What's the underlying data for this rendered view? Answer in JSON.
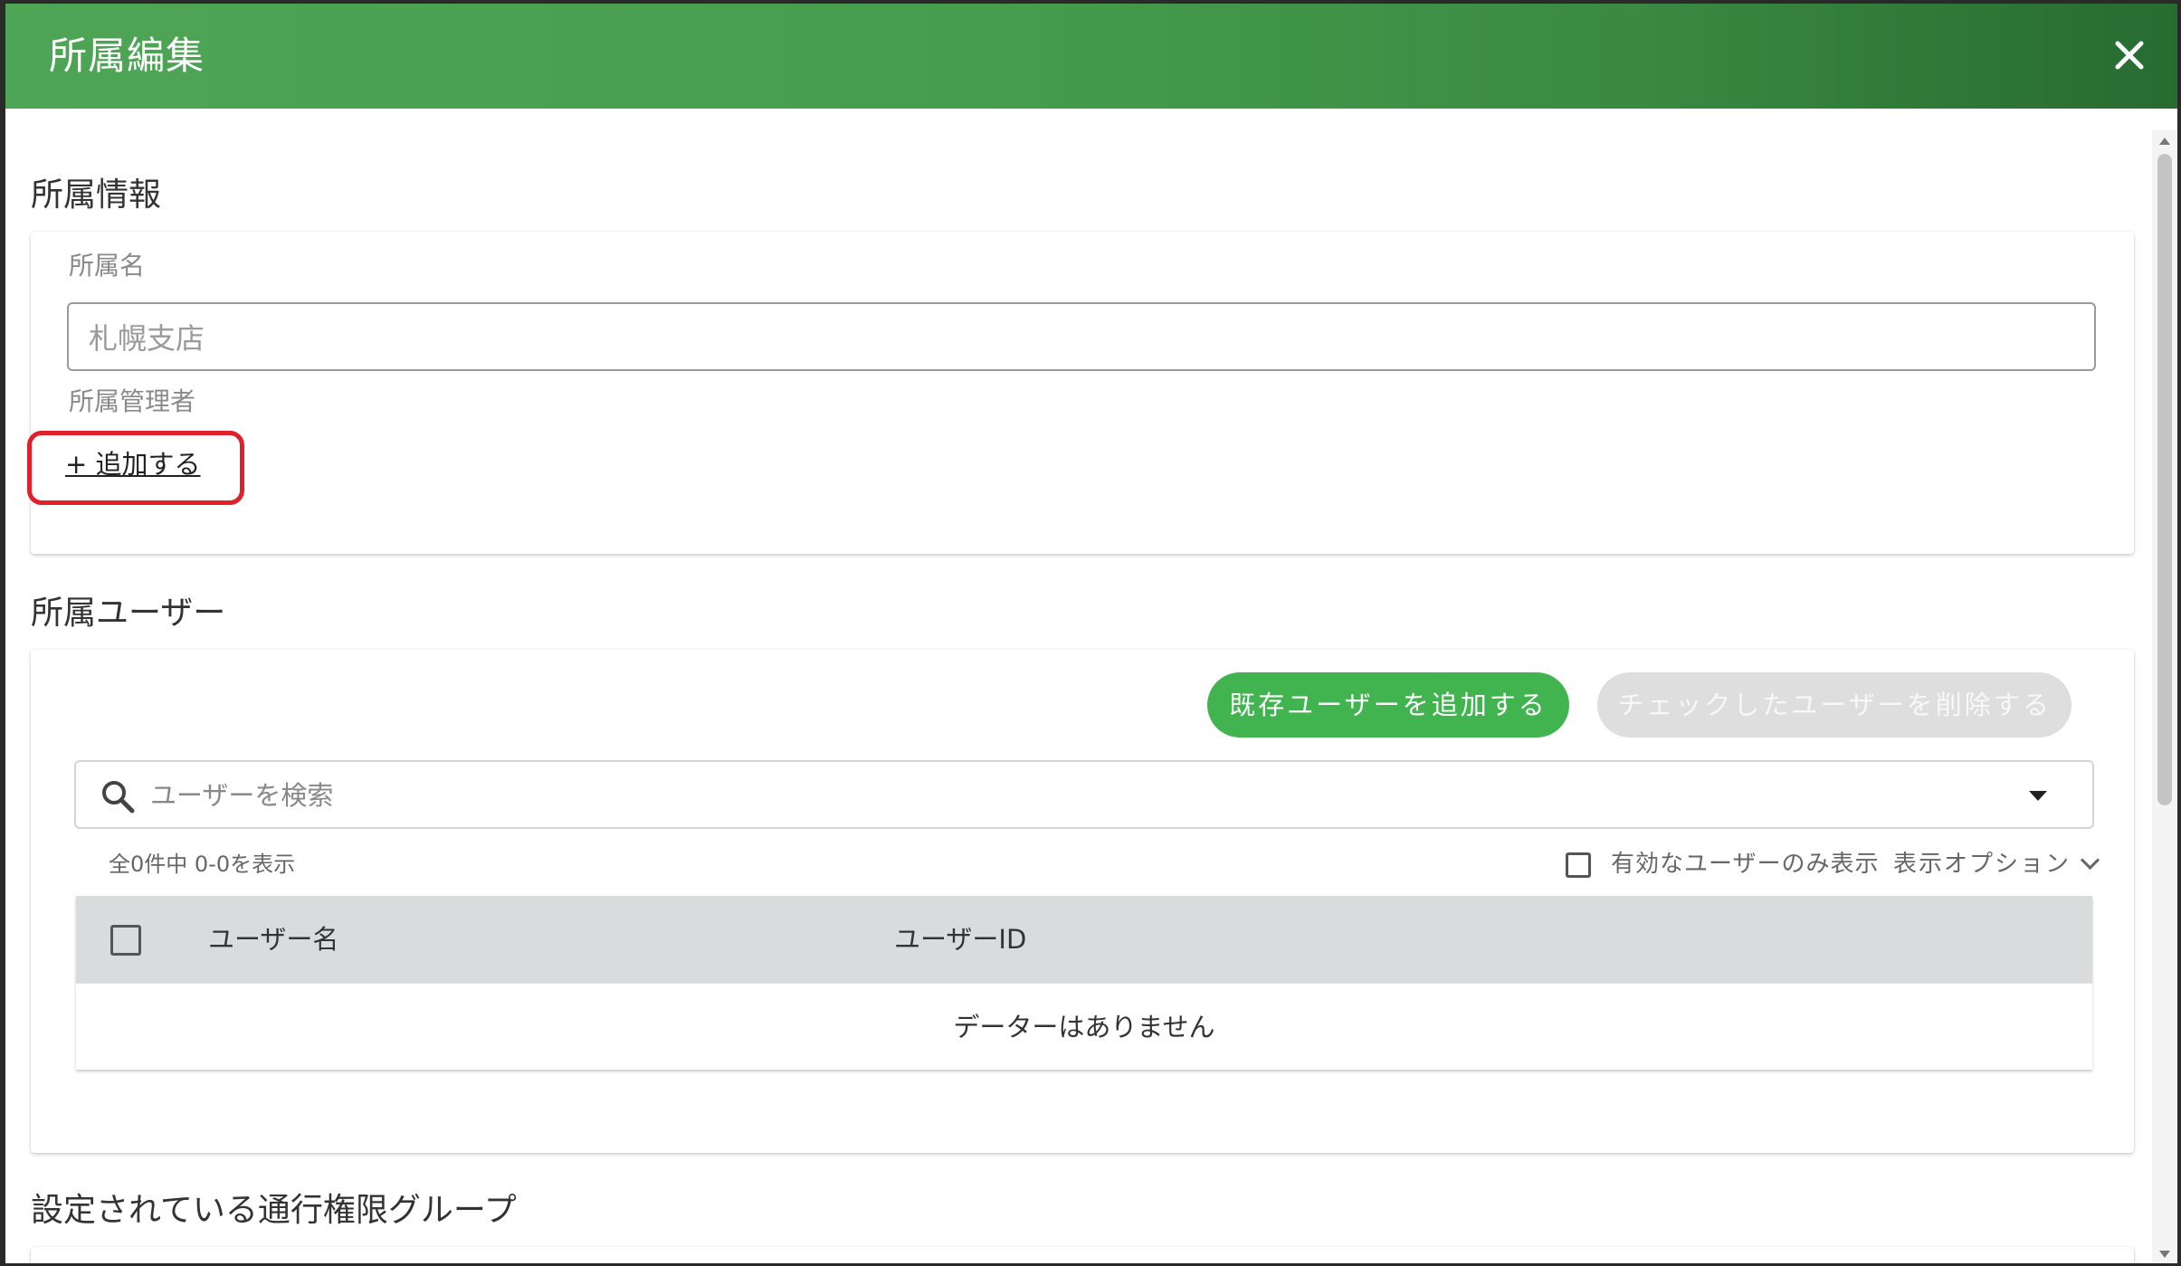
{
  "dialog": {
    "title": "所属編集",
    "close_icon": "close-icon",
    "header_gradient": [
      "#4fa556",
      "#276b30"
    ]
  },
  "affiliation_info": {
    "section_title": "所属情報",
    "name_label": "所属名",
    "name_value": "札幌支店",
    "manager_label": "所属管理者",
    "add_link": "+ 追加する",
    "highlight_color": "#e0202a"
  },
  "affiliation_users": {
    "section_title": "所属ユーザー",
    "add_existing_button": "既存ユーザーを追加する",
    "delete_checked_button": "チェックしたユーザーを削除する",
    "primary_color": "#41b34f",
    "search": {
      "placeholder": "ユーザーを検索",
      "icon": "search-icon"
    },
    "count_text": "全0件中 0-0を表示",
    "active_only_label": "有効なユーザーのみ表示",
    "display_options_label": "表示オプション",
    "table": {
      "columns": [
        "ユーザー名",
        "ユーザーID"
      ],
      "empty_message": "データーはありません"
    }
  },
  "access_groups": {
    "section_title": "設定されている通行権限グループ"
  }
}
